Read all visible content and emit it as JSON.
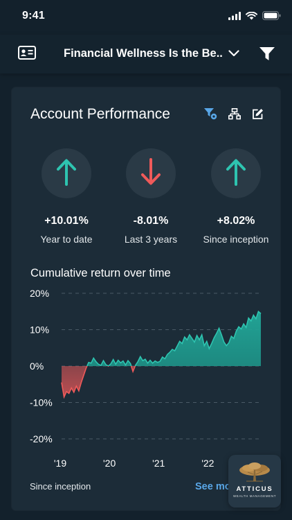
{
  "status_bar": {
    "time": "9:41"
  },
  "header": {
    "title": "Financial Wellness Is the Be.."
  },
  "card": {
    "title": "Account Performance",
    "metrics": [
      {
        "value": "+10.01%",
        "label": "Year to date",
        "direction": "up",
        "color": "#2ec4b0"
      },
      {
        "value": "-8.01%",
        "label": "Last 3 years",
        "direction": "down",
        "color": "#ef5a5a"
      },
      {
        "value": "+8.02%",
        "label": "Since inception",
        "direction": "up",
        "color": "#2ec4b0"
      }
    ],
    "chart_title": "Cumulative return over time",
    "footer_label": "Since inception",
    "see_more": "See mo"
  },
  "logo": {
    "name": "ATTICUS",
    "subtitle": "WEALTH MANAGEMENT"
  },
  "colors": {
    "positive": "#2ec4b0",
    "negative": "#ef5a5a",
    "accent": "#59a7e8"
  },
  "chart_data": {
    "type": "area",
    "ylim": [
      -20,
      20
    ],
    "y_ticks": [
      {
        "value": 20,
        "label": "20%"
      },
      {
        "value": 10,
        "label": "10%"
      },
      {
        "value": 0,
        "label": "0%"
      },
      {
        "value": -10,
        "label": "-10%"
      },
      {
        "value": -20,
        "label": "-20%"
      }
    ],
    "x_ticks": [
      {
        "value": 2019,
        "label": "'19"
      },
      {
        "value": 2020,
        "label": "'20"
      },
      {
        "value": 2021,
        "label": "'21"
      },
      {
        "value": 2022,
        "label": "'22"
      }
    ],
    "xlim": [
      2019,
      2023.05
    ],
    "grid": true,
    "series": [
      {
        "values": [
          [
            2019.0,
            -4.5
          ],
          [
            2019.05,
            -8.5
          ],
          [
            2019.1,
            -7.0
          ],
          [
            2019.15,
            -7.5
          ],
          [
            2019.2,
            -6.0
          ],
          [
            2019.25,
            -7.2
          ],
          [
            2019.3,
            -5.5
          ],
          [
            2019.35,
            -6.8
          ],
          [
            2019.4,
            -4.5
          ],
          [
            2019.45,
            -2.5
          ],
          [
            2019.5,
            -0.5
          ],
          [
            2019.55,
            1.0
          ],
          [
            2019.6,
            0.8
          ],
          [
            2019.65,
            2.2
          ],
          [
            2019.7,
            1.2
          ],
          [
            2019.75,
            0.5
          ],
          [
            2019.8,
            0.2
          ],
          [
            2019.85,
            1.5
          ],
          [
            2019.9,
            0.4
          ],
          [
            2019.95,
            0.0
          ],
          [
            2020.0,
            0.6
          ],
          [
            2020.05,
            1.8
          ],
          [
            2020.1,
            0.5
          ],
          [
            2020.15,
            1.6
          ],
          [
            2020.2,
            0.9
          ],
          [
            2020.25,
            1.4
          ],
          [
            2020.3,
            0.3
          ],
          [
            2020.35,
            1.5
          ],
          [
            2020.4,
            0.7
          ],
          [
            2020.45,
            -1.5
          ],
          [
            2020.5,
            0.2
          ],
          [
            2020.55,
            1.2
          ],
          [
            2020.6,
            2.6
          ],
          [
            2020.65,
            1.5
          ],
          [
            2020.7,
            1.9
          ],
          [
            2020.75,
            0.8
          ],
          [
            2020.8,
            1.6
          ],
          [
            2020.85,
            0.8
          ],
          [
            2020.9,
            1.4
          ],
          [
            2020.95,
            1.0
          ],
          [
            2021.0,
            1.3
          ],
          [
            2021.05,
            2.5
          ],
          [
            2021.1,
            2.0
          ],
          [
            2021.15,
            3.2
          ],
          [
            2021.2,
            3.8
          ],
          [
            2021.25,
            4.6
          ],
          [
            2021.3,
            4.2
          ],
          [
            2021.35,
            5.5
          ],
          [
            2021.4,
            6.8
          ],
          [
            2021.45,
            6.2
          ],
          [
            2021.5,
            8.0
          ],
          [
            2021.55,
            7.2
          ],
          [
            2021.6,
            8.6
          ],
          [
            2021.65,
            7.6
          ],
          [
            2021.7,
            6.6
          ],
          [
            2021.75,
            8.4
          ],
          [
            2021.8,
            7.2
          ],
          [
            2021.85,
            8.6
          ],
          [
            2021.9,
            5.6
          ],
          [
            2021.95,
            6.8
          ],
          [
            2022.0,
            4.8
          ],
          [
            2022.05,
            6.2
          ],
          [
            2022.1,
            7.8
          ],
          [
            2022.15,
            9.0
          ],
          [
            2022.2,
            10.4
          ],
          [
            2022.25,
            8.6
          ],
          [
            2022.3,
            6.6
          ],
          [
            2022.35,
            5.6
          ],
          [
            2022.4,
            6.4
          ],
          [
            2022.45,
            8.2
          ],
          [
            2022.5,
            7.6
          ],
          [
            2022.55,
            9.6
          ],
          [
            2022.6,
            10.8
          ],
          [
            2022.65,
            10.2
          ],
          [
            2022.7,
            11.6
          ],
          [
            2022.75,
            10.6
          ],
          [
            2022.8,
            13.2
          ],
          [
            2022.85,
            12.4
          ],
          [
            2022.9,
            14.0
          ],
          [
            2022.95,
            13.0
          ],
          [
            2023.0,
            15.0
          ],
          [
            2023.05,
            14.4
          ]
        ]
      }
    ]
  }
}
